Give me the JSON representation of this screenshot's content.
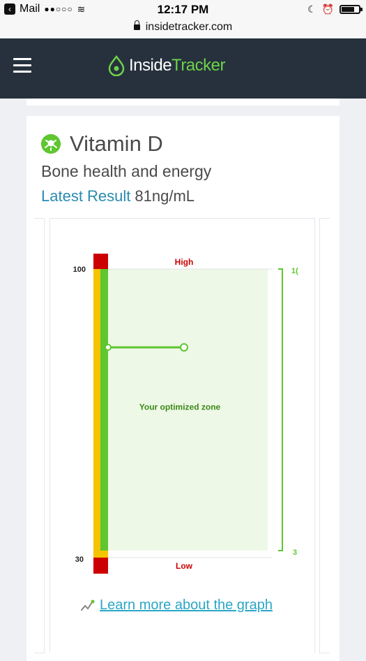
{
  "status_bar": {
    "carrier": "Mail",
    "signal": "●●○○○",
    "time": "12:17 PM"
  },
  "browser": {
    "url": "insidetracker.com"
  },
  "header": {
    "logo_part1": "Inside",
    "logo_part2": "Tracker"
  },
  "biomarker": {
    "name": "Vitamin D",
    "description": "Bone health and energy",
    "latest_label": "Latest Result",
    "latest_value": "81ng/mL"
  },
  "chart_data": {
    "type": "range-gauge",
    "title": "",
    "scale_min": 30,
    "scale_max": 100,
    "tick_labels": [
      "100",
      "30"
    ],
    "high_label": "High",
    "low_label": "Low",
    "zone_label": "Your optimized zone",
    "optimized_range": [
      30,
      100
    ],
    "range_top_label": "1(",
    "range_bottom_label": "3",
    "result_value": 81,
    "colors": {
      "high": "#cc0000",
      "low": "#cc0000",
      "caution": "#f5c400",
      "optimal": "#5ec62f",
      "zone_fill": "#eef8e6",
      "zone_text": "#3a8a1a"
    }
  },
  "learn_link": "Learn more about the graph"
}
